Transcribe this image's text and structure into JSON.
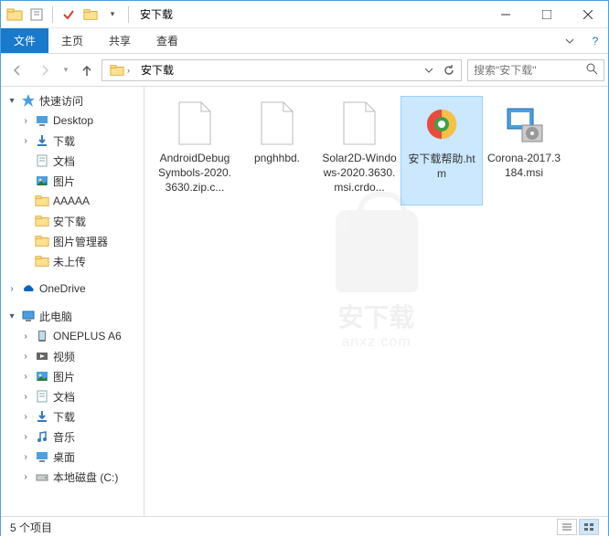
{
  "title": "安下载",
  "ribbon": {
    "file": "文件",
    "home": "主页",
    "share": "共享",
    "view": "查看"
  },
  "address": {
    "crumb": "安下载"
  },
  "search": {
    "placeholder": "搜索\"安下载\""
  },
  "sidebar": {
    "quickaccess": "快速访问",
    "desktop": "Desktop",
    "downloads": "下载",
    "documents": "文档",
    "pictures": "图片",
    "aaaaa": "AAAAA",
    "anxz": "安下载",
    "picmgr": "图片管理器",
    "notuploaded": "未上传",
    "onedrive": "OneDrive",
    "thispc": "此电脑",
    "oneplus": "ONEPLUS A6",
    "videos": "视频",
    "pictures2": "图片",
    "documents2": "文档",
    "downloads2": "下载",
    "music": "音乐",
    "desktop2": "桌面",
    "localdisk": "本地磁盘 (C:)"
  },
  "files": {
    "f1": "AndroidDebugSymbols-2020.3630.zip.c...",
    "f2": "pnghhbd.",
    "f3": "Solar2D-Windows-2020.3630.msi.crdo...",
    "f4": "安下载帮助.htm",
    "f5": "Corona-2017.3184.msi"
  },
  "status": {
    "count": "5 个项目"
  },
  "watermark": {
    "t1": "安下载",
    "t2": "anxz.com"
  }
}
